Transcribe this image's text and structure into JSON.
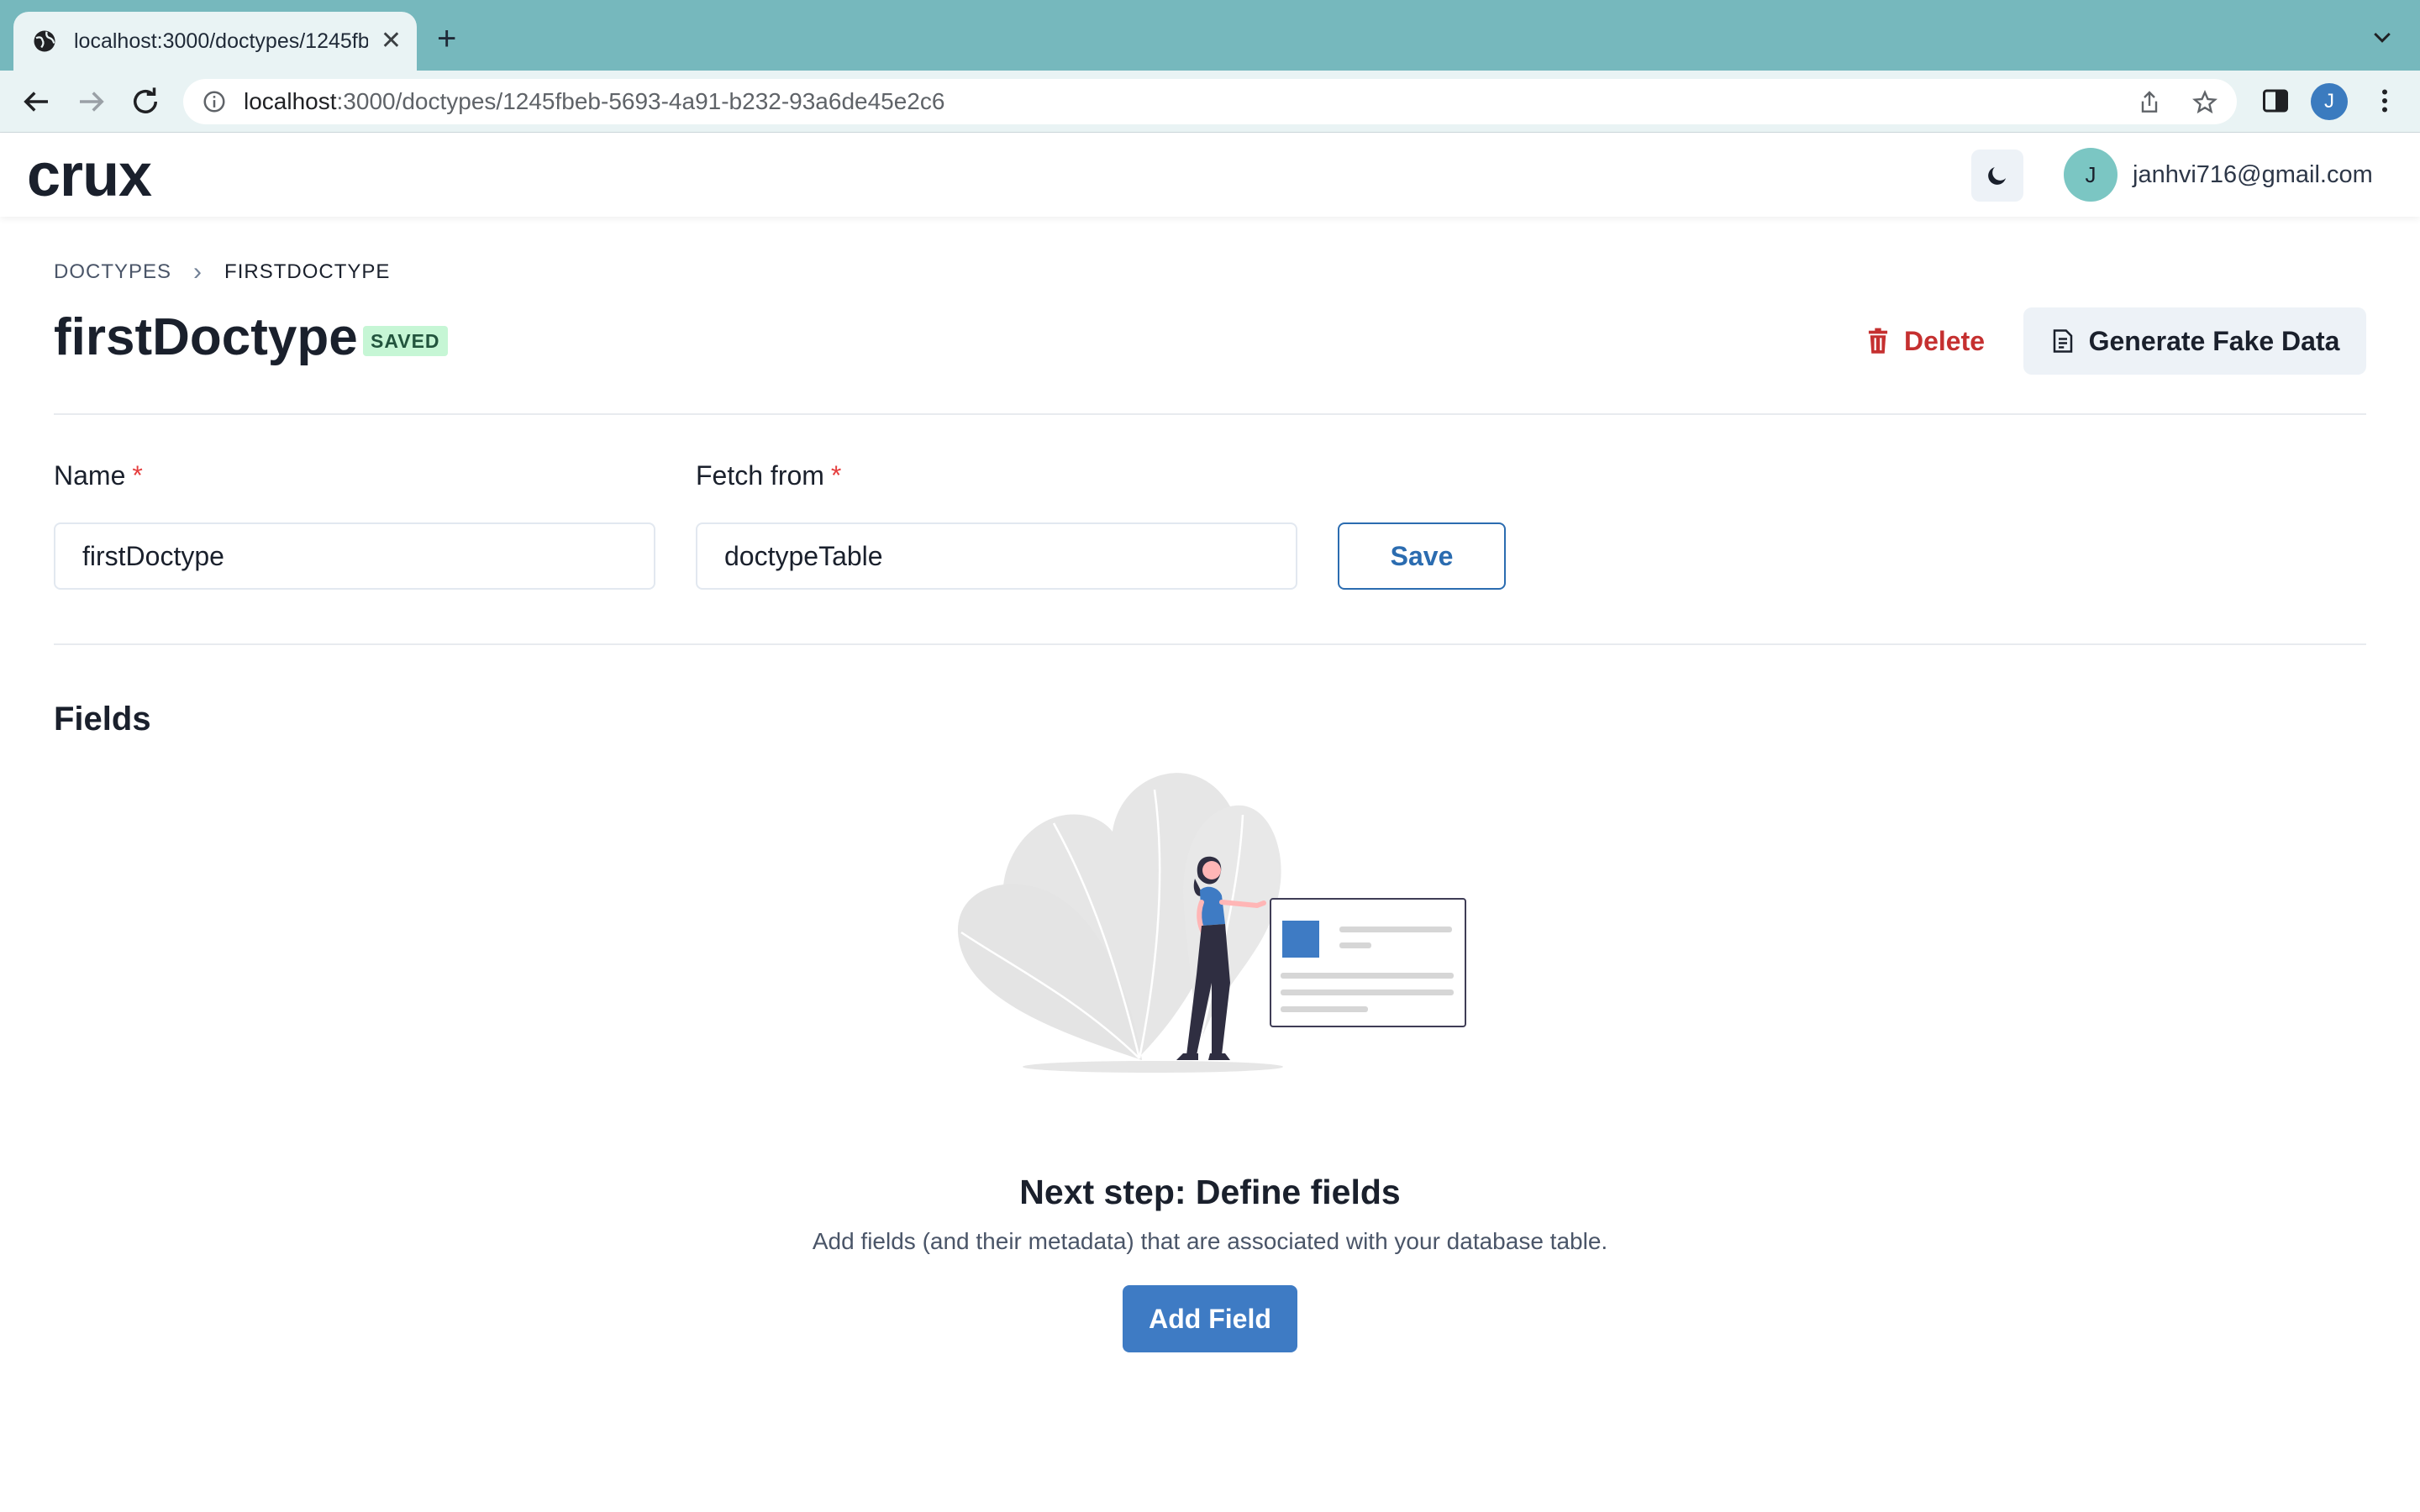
{
  "browser": {
    "tab_title": "localhost:3000/doctypes/1245fbeb-5693-4a91-b232-93a6de45e2c6",
    "url_host": "localhost",
    "url_rest": ":3000/doctypes/1245fbeb-5693-4a91-b232-93a6de45e2c6",
    "profile_initial": "J",
    "colors": {
      "tabbar": "#76b8bd",
      "toolbar": "#e9f3f4"
    }
  },
  "header": {
    "logo": "crux",
    "user_initial": "J",
    "user_email": "janhvi716@gmail.com",
    "theme_icon": "moon-icon"
  },
  "breadcrumb": {
    "parent": "DOCTYPES",
    "current": "FIRSTDOCTYPE"
  },
  "page": {
    "title": "firstDoctype",
    "status_badge": "SAVED",
    "delete_label": "Delete",
    "fake_data_label": "Generate Fake Data"
  },
  "form": {
    "name_label": "Name",
    "name_value": "firstDoctype",
    "fetch_label": "Fetch from",
    "fetch_value": "doctypeTable",
    "required_mark": "*",
    "save_label": "Save"
  },
  "fields": {
    "heading": "Fields",
    "empty_title": "Next step: Define fields",
    "empty_description": "Add fields (and their metadata) that are associated with your database table.",
    "add_label": "Add Field"
  },
  "colors": {
    "danger": "#c53030",
    "primary": "#3e7bc4",
    "badge_bg": "#c6f6d5",
    "badge_text": "#22543d"
  }
}
